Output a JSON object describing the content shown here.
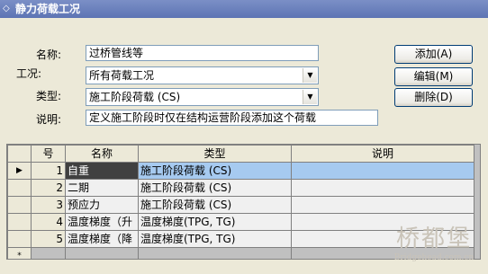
{
  "window": {
    "title": "静力荷载工况"
  },
  "form": {
    "name_label": "名称:",
    "name_value": "过桥管线等",
    "case_label": "工况:",
    "case_value": "所有荷载工况",
    "type_label": "类型:",
    "type_value": "施工阶段荷载 (CS)",
    "desc_label": "说明:",
    "desc_value": "定义施工阶段时仅在结构运营阶段添加这个荷载"
  },
  "buttons": {
    "add": "添加(A)",
    "edit": "编辑(M)",
    "delete": "删除(D)"
  },
  "table": {
    "headers": [
      "号",
      "名称",
      "类型",
      "说明"
    ],
    "rows": [
      {
        "indicator": "▶",
        "num": "1",
        "name": "自重",
        "type": "施工阶段荷载 (CS)",
        "desc": ""
      },
      {
        "indicator": "",
        "num": "2",
        "name": "二期",
        "type": "施工阶段荷载 (CS)",
        "desc": ""
      },
      {
        "indicator": "",
        "num": "3",
        "name": "预应力",
        "type": "施工阶段荷载 (CS)",
        "desc": ""
      },
      {
        "indicator": "",
        "num": "4",
        "name": "温度梯度（升",
        "type": "温度梯度(TPG, TG)",
        "desc": ""
      },
      {
        "indicator": "",
        "num": "5",
        "name": "温度梯度（降",
        "type": "温度梯度(TPG, TG)",
        "desc": ""
      }
    ],
    "new_row_indicator": "*"
  },
  "watermark": {
    "text": "桥都堡",
    "url": "Bridgehead.com.cn"
  }
}
